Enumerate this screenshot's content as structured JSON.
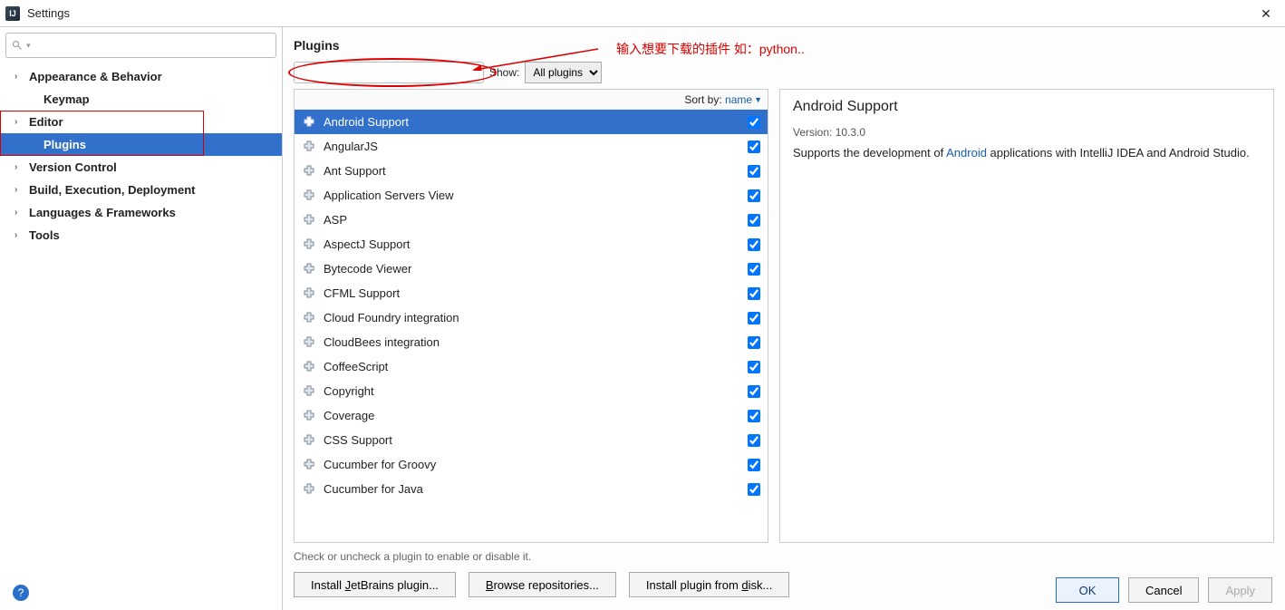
{
  "window": {
    "title": "Settings"
  },
  "sidebar": {
    "items": [
      {
        "label": "Appearance & Behavior",
        "arrow": true
      },
      {
        "label": "Keymap",
        "arrow": false,
        "child": true
      },
      {
        "label": "Editor",
        "arrow": true
      },
      {
        "label": "Plugins",
        "arrow": false,
        "child": true,
        "selected": true
      },
      {
        "label": "Version Control",
        "arrow": true
      },
      {
        "label": "Build, Execution, Deployment",
        "arrow": true
      },
      {
        "label": "Languages & Frameworks",
        "arrow": true
      },
      {
        "label": "Tools",
        "arrow": true
      }
    ]
  },
  "content": {
    "title": "Plugins",
    "show_label": "Show:",
    "show_value": "All plugins",
    "sort_label": "Sort by:",
    "sort_value": "name"
  },
  "plugins": [
    {
      "name": "Android Support",
      "checked": true,
      "selected": true
    },
    {
      "name": "AngularJS",
      "checked": true
    },
    {
      "name": "Ant Support",
      "checked": true
    },
    {
      "name": "Application Servers View",
      "checked": true
    },
    {
      "name": "ASP",
      "checked": true
    },
    {
      "name": "AspectJ Support",
      "checked": true
    },
    {
      "name": "Bytecode Viewer",
      "checked": true
    },
    {
      "name": "CFML Support",
      "checked": true
    },
    {
      "name": "Cloud Foundry integration",
      "checked": true
    },
    {
      "name": "CloudBees integration",
      "checked": true
    },
    {
      "name": "CoffeeScript",
      "checked": true
    },
    {
      "name": "Copyright",
      "checked": true
    },
    {
      "name": "Coverage",
      "checked": true
    },
    {
      "name": "CSS Support",
      "checked": true
    },
    {
      "name": "Cucumber for Groovy",
      "checked": true
    },
    {
      "name": "Cucumber for Java",
      "checked": true
    }
  ],
  "detail": {
    "title": "Android Support",
    "version_label": "Version:",
    "version": "10.3.0",
    "desc_pre": "Supports the development of ",
    "desc_link": "Android",
    "desc_post": " applications with IntelliJ IDEA and Android Studio."
  },
  "hint": "Check or uncheck a plugin to enable or disable it.",
  "buttons": {
    "jetbrains_pre": "Install ",
    "jetbrains_u": "J",
    "jetbrains_post": "etBrains plugin...",
    "browse_u": "B",
    "browse_post": "rowse repositories...",
    "disk_pre": "Install plugin from ",
    "disk_u": "d",
    "disk_post": "isk..."
  },
  "footer": {
    "ok": "OK",
    "cancel": "Cancel",
    "apply": "Apply"
  },
  "annotation": "输入想要下载的插件 如：python.."
}
